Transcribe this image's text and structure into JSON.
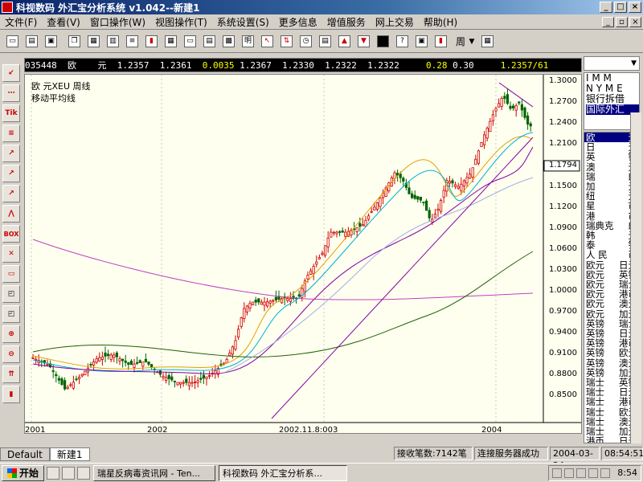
{
  "window": {
    "title": "科视数码 外汇宝分析系统 v1.042--新建1"
  },
  "menu": [
    "文件(F)",
    "查看(V)",
    "窗口操作(W)",
    "视图操作(T)",
    "系统设置(S)",
    "更多信息",
    "增值服务",
    "网上交易",
    "帮助(H)"
  ],
  "toolbar": {
    "week_label": "周"
  },
  "quote": {
    "code": "035448",
    "name": "欧    元",
    "v1": "1.2357",
    "v2": "1.2361",
    "chg": "0.0035",
    "v3": "1.2367",
    "v4": "1.2330",
    "v5": "1.2322",
    "v6": "1.2322",
    "r1": "0.28",
    "r2": "0.30",
    "last": "1.2357/61"
  },
  "chart": {
    "label1": "欧    元XEU    周线",
    "label2": "移动平均线",
    "highlight_price": "1.1794",
    "y_ticks": [
      "1.3000",
      "1.2700",
      "1.2400",
      "1.2100",
      "1.1794",
      "1.1500",
      "1.1200",
      "1.0900",
      "1.0600",
      "1.0300",
      "1.0000",
      "0.9700",
      "0.9400",
      "0.9100",
      "0.8800",
      "0.8500"
    ],
    "x_ticks": [
      "2001",
      "2002",
      "2002.11.8:003",
      "2004"
    ]
  },
  "right_panel": {
    "top_items": [
      "I M M",
      "N Y M E",
      "银行拆借",
      "国际外汇"
    ],
    "list": [
      [
        "欧",
        "元"
      ],
      [
        "日",
        "元"
      ],
      [
        "英",
        "镑"
      ],
      [
        "澳",
        "元"
      ],
      [
        "瑞",
        "郎"
      ],
      [
        "加",
        "元"
      ],
      [
        "纽",
        "元"
      ],
      [
        "星",
        "市"
      ],
      [
        "港",
        "市"
      ],
      [
        "瑞典克",
        "郎"
      ],
      [
        "韩",
        "元"
      ],
      [
        "泰",
        "铢"
      ],
      [
        "人 民",
        "币"
      ],
      [
        "欧元",
        "日元"
      ],
      [
        "欧元",
        "英镑"
      ],
      [
        "欧元",
        "瑞士"
      ],
      [
        "欧元",
        "港币"
      ],
      [
        "欧元",
        "澳元"
      ],
      [
        "欧元",
        "加元"
      ],
      [
        "英镑",
        "瑞士"
      ],
      [
        "英镑",
        "日元"
      ],
      [
        "英镑",
        "港币"
      ],
      [
        "英镑",
        "欧元"
      ],
      [
        "英镑",
        "澳元"
      ],
      [
        "英镑",
        "加元"
      ],
      [
        "瑞士",
        "英镑"
      ],
      [
        "瑞士",
        "日元"
      ],
      [
        "瑞士",
        "港币"
      ],
      [
        "瑞士",
        "欧元"
      ],
      [
        "瑞士",
        "澳元"
      ],
      [
        "瑞士",
        "加元"
      ],
      [
        "港币",
        "日元"
      ]
    ]
  },
  "tabs": [
    "Default",
    "新建1"
  ],
  "status": {
    "records": "接收笔数:7142笔",
    "conn": "连接服务器成功",
    "date": "2004-03-24",
    "time": "08:54:51"
  },
  "taskbar": {
    "start": "开始",
    "tasks": [
      "瑞星反病毒资讯网 - Ten...",
      "科视数码 外汇宝分析系..."
    ],
    "clock": "8:54"
  }
}
